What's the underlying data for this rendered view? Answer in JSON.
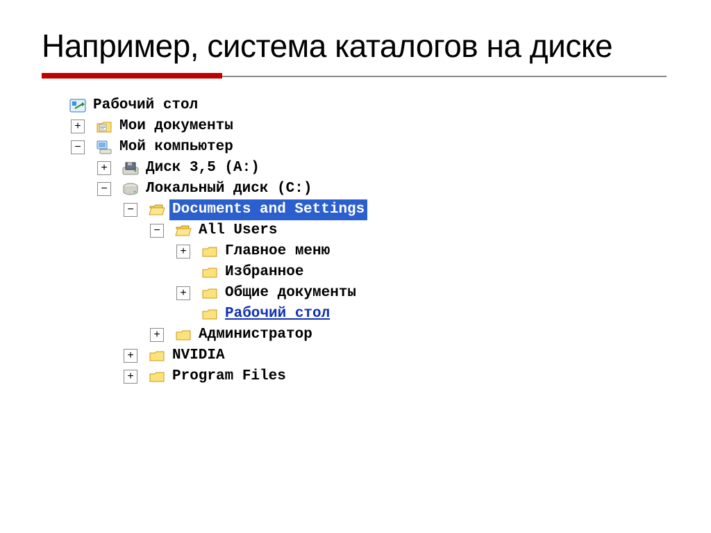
{
  "title": "Например, система каталогов на диске",
  "tree": {
    "desktop": "Рабочий стол",
    "my_documents": "Мои документы",
    "my_computer": "Мой компьютер",
    "floppy": "Диск 3,5 (A:)",
    "local_disk": "Локальный диск (C:)",
    "docs_settings": "Documents and Settings",
    "all_users": "All Users",
    "main_menu": "Главное меню",
    "favorites": "Избранное",
    "shared_docs": "Общие документы",
    "desktop_sub": "Рабочий стол",
    "administrator": "Администратор",
    "nvidia": "NVIDIA",
    "program_files": "Program Files"
  }
}
